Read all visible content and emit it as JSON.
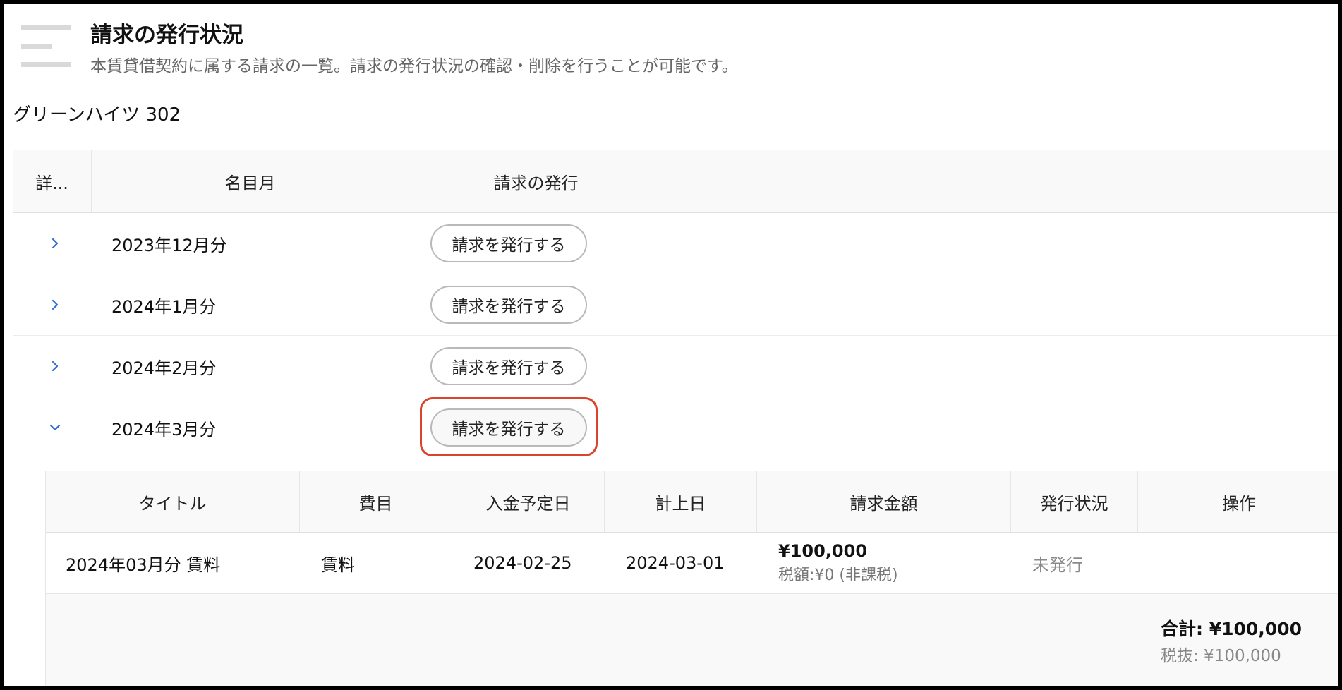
{
  "header": {
    "title": "請求の発行状況",
    "subtitle": "本賃貸借契約に属する請求の一覧。請求の発行状況の確認・削除を行うことが可能です。"
  },
  "property": {
    "name": "グリーンハイツ 302"
  },
  "main_table": {
    "columns": {
      "detail": "詳...",
      "month": "名目月",
      "issue": "請求の発行"
    },
    "rows": [
      {
        "month": "2023年12月分",
        "button": "請求を発行する",
        "expanded": false
      },
      {
        "month": "2024年1月分",
        "button": "請求を発行する",
        "expanded": false
      },
      {
        "month": "2024年2月分",
        "button": "請求を発行する",
        "expanded": false
      },
      {
        "month": "2024年3月分",
        "button": "請求を発行する",
        "expanded": true
      }
    ]
  },
  "detail_table": {
    "columns": {
      "title": "タイトル",
      "category": "費目",
      "due_date": "入金予定日",
      "record_date": "計上日",
      "amount": "請求金額",
      "status": "発行状況",
      "actions": "操作"
    },
    "rows": [
      {
        "title": "2024年03月分 賃料",
        "category": "賃料",
        "due_date": "2024-02-25",
        "record_date": "2024-03-01",
        "amount": "¥100,000",
        "tax": "税額:¥0 (非課税)",
        "status": "未発行"
      }
    ],
    "total": {
      "label": "合計: ¥100,000",
      "excl_tax": "税抜: ¥100,000"
    }
  },
  "colors": {
    "accent": "#2f6fd0",
    "highlight": "#d9442d"
  }
}
